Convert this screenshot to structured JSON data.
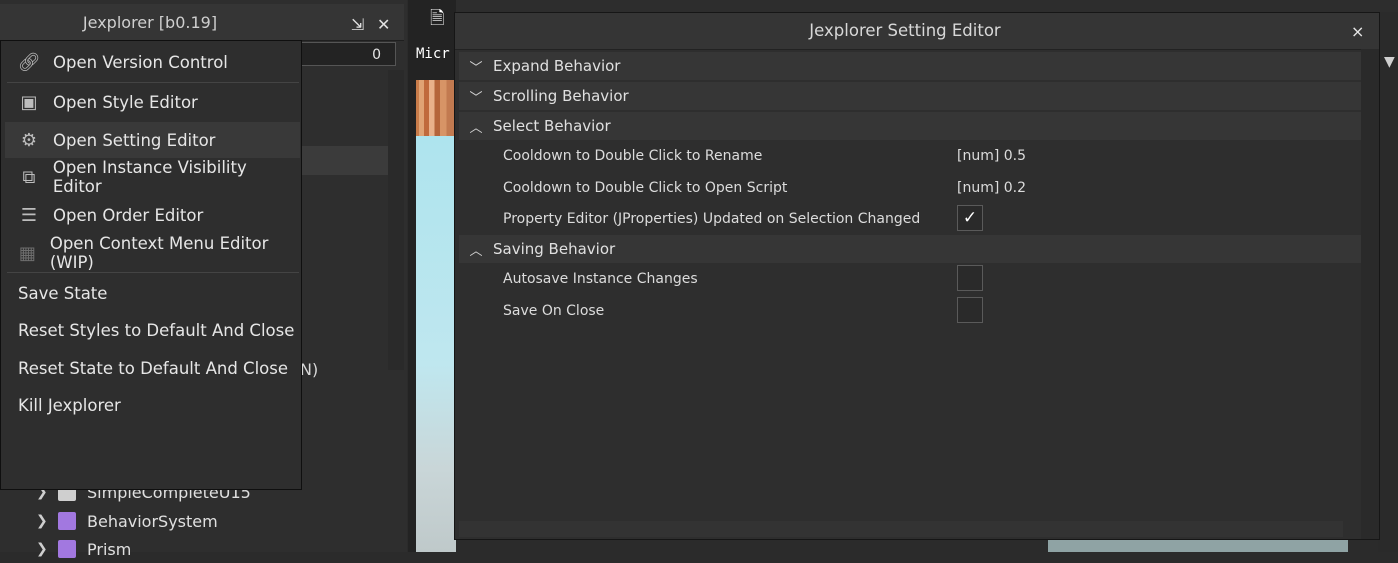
{
  "explorer": {
    "title": "Jexplorer [b0.19]",
    "search_count": "0",
    "partial_text": "N)",
    "tree_items": [
      {
        "label": "SimpleCompleteU15",
        "color": "#cfcfcf"
      },
      {
        "label": "BehaviorSystem",
        "color": "#a278e0"
      },
      {
        "label": "Prism",
        "color": "#a278e0"
      }
    ]
  },
  "context_menu": {
    "items": [
      {
        "label": "Open Version Control",
        "icon": "link-icon"
      },
      {
        "label": "Open Style Editor",
        "icon": "style-document-icon"
      },
      {
        "label": "Open Setting Editor",
        "icon": "gear-icon"
      },
      {
        "label": "Open Instance Visibility Editor",
        "icon": "visibility-cursor-icon"
      },
      {
        "label": "Open Order Editor",
        "icon": "list-icon"
      },
      {
        "label": "Open Context Menu Editor (WIP)",
        "icon": "grid-icon"
      },
      {
        "label": "Save State"
      },
      {
        "label": "Reset Styles to Default And Close"
      },
      {
        "label": "Reset State to Default And Close"
      },
      {
        "label": "Kill Jexplorer"
      }
    ]
  },
  "viewport": {
    "label": "Micr"
  },
  "dialog": {
    "title": "Jexplorer Setting Editor",
    "close_glyph": "×",
    "sections": [
      {
        "label": "Expand Behavior",
        "expanded": false
      },
      {
        "label": "Scrolling Behavior",
        "expanded": false
      },
      {
        "label": "Select Behavior",
        "expanded": true
      },
      {
        "label": "Saving Behavior",
        "expanded": true
      }
    ],
    "select_settings": [
      {
        "label": "Cooldown to Double Click to Rename",
        "value": "[num] 0.5"
      },
      {
        "label": "Cooldown to Double Click to Open Script",
        "value": "[num] 0.2"
      },
      {
        "label": "Property Editor (JProperties) Updated on Selection Changed",
        "checked": true
      }
    ],
    "saving_settings": [
      {
        "label": "Autosave Instance Changes",
        "checked": false
      },
      {
        "label": "Save On Close",
        "checked": false
      }
    ],
    "check_glyph": "✓"
  }
}
